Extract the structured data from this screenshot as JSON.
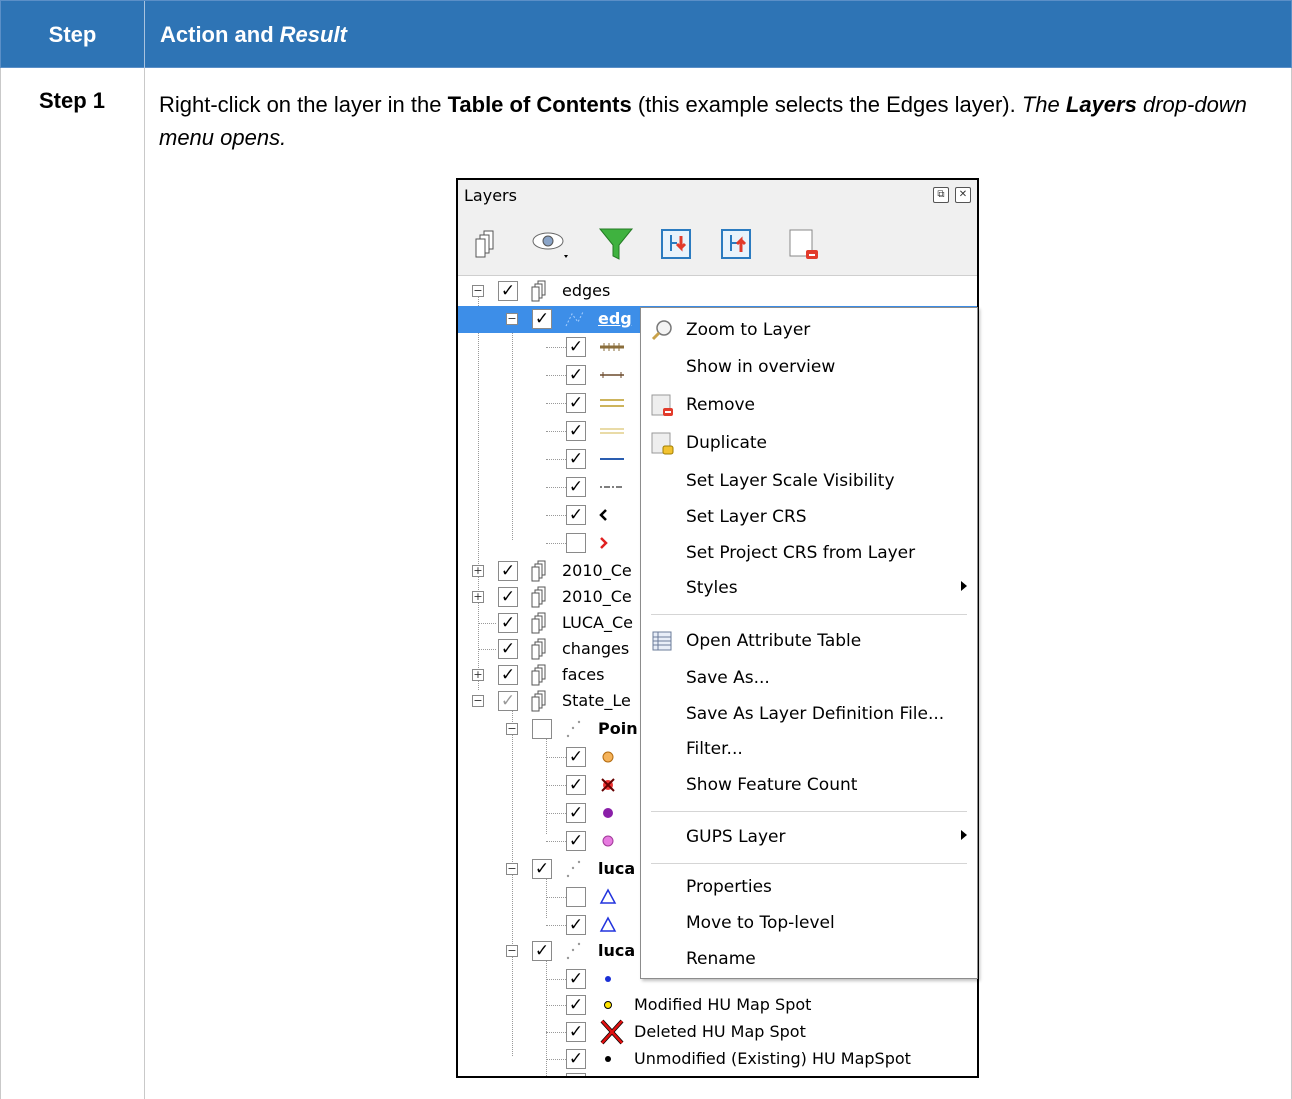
{
  "header": {
    "step": "Step",
    "action": "Action and",
    "action_result": "Result"
  },
  "step1": {
    "label": "Step 1",
    "instr_a": "Right-click on the layer in the",
    "instr_b": "Table of Contents",
    "instr_c": "(this example selects the Edges layer).",
    "instr_d": "The",
    "instr_e": "Layers",
    "instr_f": "drop-down menu opens."
  },
  "panel": {
    "title": "Layers",
    "tree": {
      "edges": "edges",
      "edges_sel": "edg",
      "r2010a": "2010_Ce",
      "r2010b": "2010_Ce",
      "luca": "LUCA_Ce",
      "changes": "changes",
      "faces": "faces",
      "state": "State_Le",
      "poin": "Poin",
      "luca1": "luca",
      "luca2": "luca",
      "modified": "Modified HU Map Spot",
      "deleted": "Deleted HU Map Spot",
      "unmodified": "Unmodified (Existing) HU MapSpot"
    }
  },
  "menu": {
    "zoom": "Zoom to Layer",
    "overview": "Show in overview",
    "remove": "Remove",
    "duplicate": "Duplicate",
    "scale": "Set Layer Scale Visibility",
    "crs": "Set Layer CRS",
    "project_crs": "Set Project CRS from Layer",
    "styles": "Styles",
    "attr": "Open Attribute Table",
    "save_as": "Save As...",
    "save_def": "Save As Layer Definition File...",
    "filter": "Filter...",
    "count": "Show Feature Count",
    "gups": "GUPS Layer",
    "props": "Properties",
    "move_top": "Move to Top-level",
    "rename": "Rename"
  },
  "colors": {
    "header_bg": "#2e74b5",
    "selection": "#3d8ee8"
  }
}
